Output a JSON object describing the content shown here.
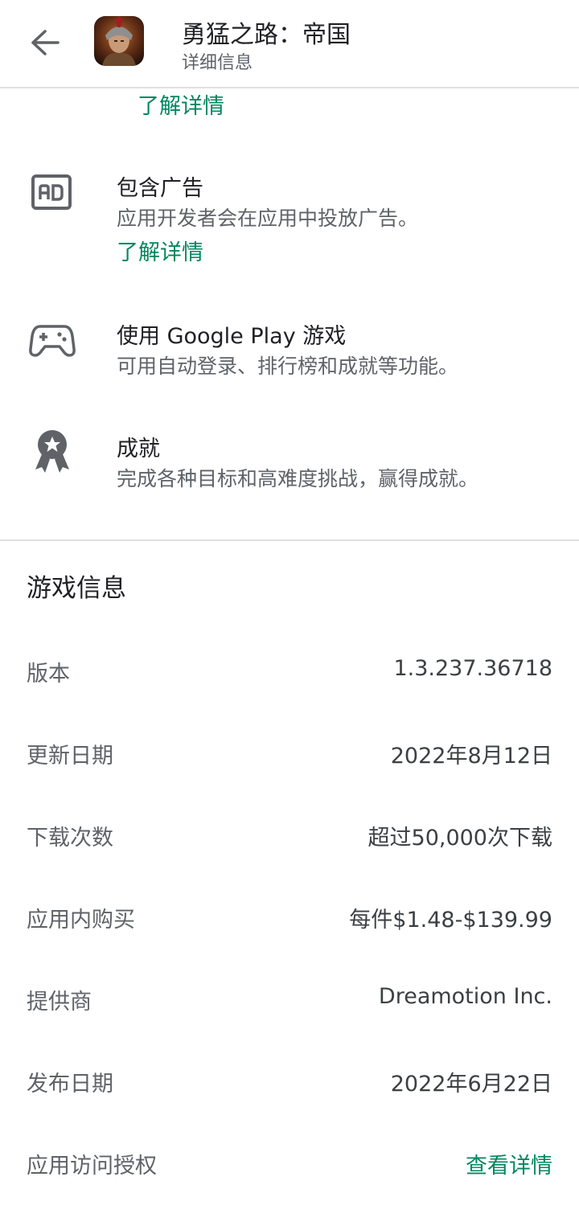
{
  "header": {
    "title": "勇猛之路：帝国",
    "subtitle": "详细信息",
    "back_icon": "arrow-left-icon",
    "app_icon": "app-icon"
  },
  "top_learn_more": "了解详情",
  "features": [
    {
      "icon": "ad-icon",
      "title": "包含广告",
      "desc": "应用开发者会在应用中投放广告。",
      "link": "了解详情"
    },
    {
      "icon": "gamepad-icon",
      "title": "使用 Google Play 游戏",
      "desc": "可用自动登录、排行榜和成就等功能。"
    },
    {
      "icon": "achievement-icon",
      "title": "成就",
      "desc": "完成各种目标和高难度挑战，赢得成就。"
    }
  ],
  "game_info": {
    "title": "游戏信息",
    "rows": [
      {
        "label": "版本",
        "value": "1.3.237.36718"
      },
      {
        "label": "更新日期",
        "value": "2022年8月12日"
      },
      {
        "label": "下载次数",
        "value": "超过50,000次下载"
      },
      {
        "label": "应用内购买",
        "value": "每件$1.48-$139.99"
      },
      {
        "label": "提供商",
        "value": "Dreamotion Inc."
      },
      {
        "label": "发布日期",
        "value": "2022年6月22日"
      },
      {
        "label": "应用访问授权",
        "value": "查看详情"
      }
    ]
  },
  "colors": {
    "accent_green": "#01875f",
    "text_primary": "#202124",
    "text_secondary": "#5f6368",
    "divider": "#e0e0e0"
  }
}
